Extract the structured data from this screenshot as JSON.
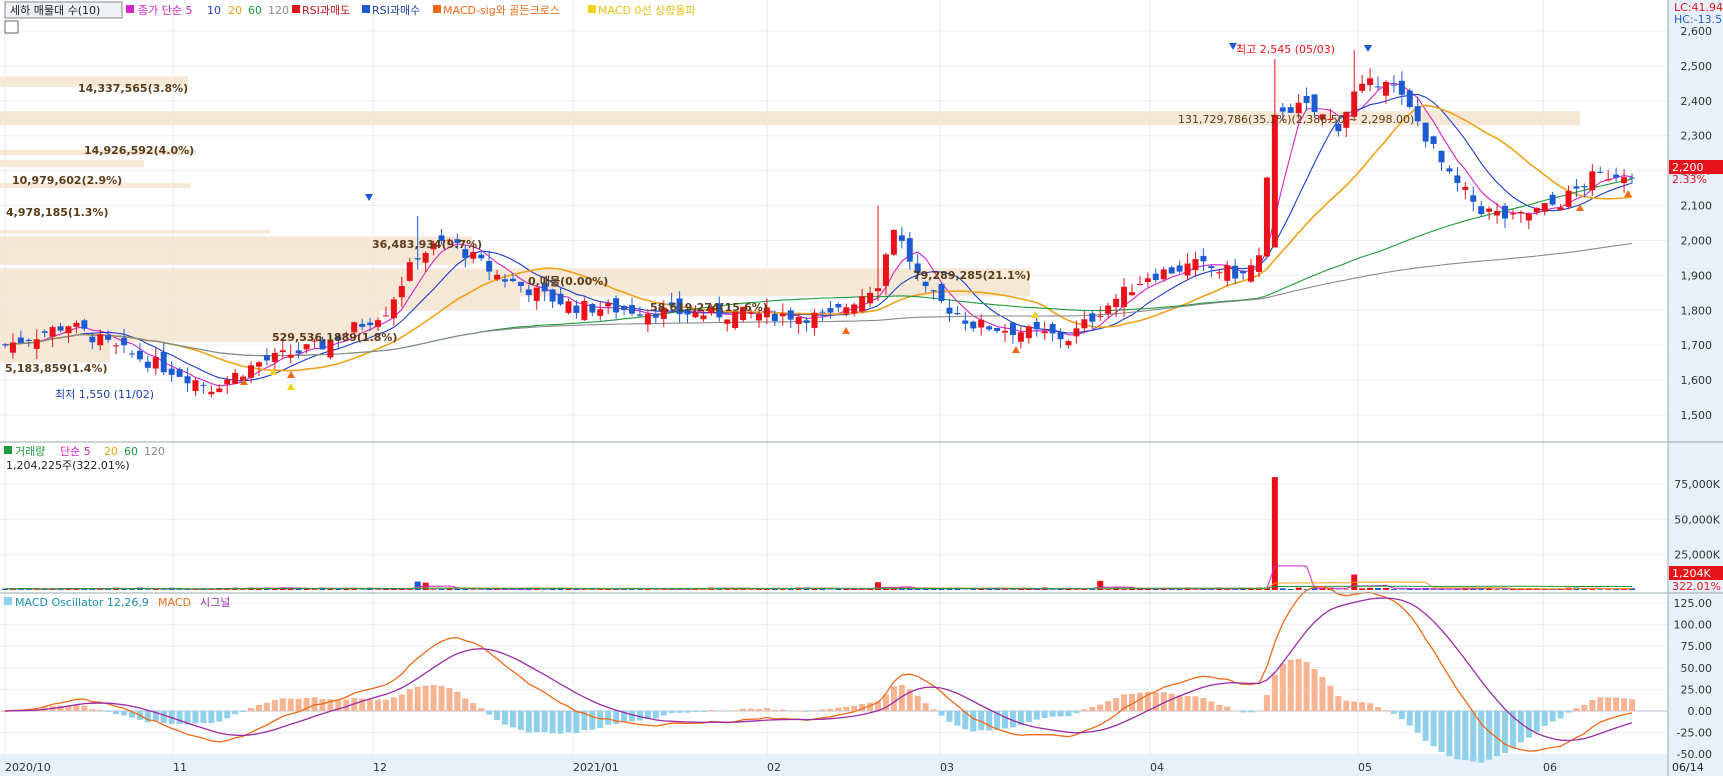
{
  "colors": {
    "up": "#e8121b",
    "down": "#1d5bd3",
    "ma5": "#d524c8",
    "ma10": "#1c3dcc",
    "ma20": "#f0a21b",
    "ma60": "#1e9a3c",
    "ma120": "#8a8a8a",
    "volume_bar_area": "#f5e6d3",
    "macd_line": "#ee6a1a",
    "signal_line": "#9b2ba6",
    "osc_pos": "#f6b493",
    "osc_neg": "#8fd0ec"
  },
  "price_panel": {
    "legend": {
      "title_button": "세하 매물대 수(10)",
      "ma_label": "종가 단순 5",
      "ma10": "10",
      "ma20": "20",
      "ma60": "60",
      "ma120": "120",
      "signal1": "RSI과매도",
      "signal2": "RSI과매수",
      "signal3": "MACD-sig와 골든크로스",
      "signal4": "MACD 0선 상향돌파"
    },
    "corner": {
      "lc": "LC:41.94",
      "hc": "HC:-13.56"
    },
    "price_badge": "2,200",
    "change_badge": "2.33%",
    "high_note": "최고 2,545 (05/03)",
    "low_note": "최저 1,550 (11/02)",
    "range_note": "131,729,786(35.1%)(2,386.50 ~ 2,298.00)",
    "profile_labels": [
      "14,337,565(3.8%)",
      "14,926,592(4.0%)",
      "10,979,602(2.9%)",
      "4,978,185(1.3%)",
      "36,483,934(9.7%)",
      "79,289,285(21.1%)",
      "529,536,1889(1.8%)",
      "5,183,859(1.4%)",
      "0,매물(0.00%)",
      "58,619,274(15.6%)"
    ],
    "y_ticks": [
      "2,600",
      "2,500",
      "2,400",
      "2,300",
      "2,200",
      "2,100",
      "2,000",
      "1,900",
      "1,800",
      "1,700",
      "1,600",
      "1,500"
    ]
  },
  "volume_panel": {
    "legend": {
      "name": "거래량",
      "ma_label": "단순 5",
      "ma20": "20",
      "ma60": "60",
      "ma120": "120"
    },
    "current": "1,204,225주(322.01%)",
    "badge_value": "1,204K",
    "badge_pct": "322.01%",
    "y_ticks": [
      "75,000K",
      "50,000K",
      "25,000K"
    ]
  },
  "macd_panel": {
    "legend": {
      "osc": "MACD Oscillator 12,26,9",
      "macd": "MACD",
      "signal": "시그널"
    },
    "y_ticks": [
      "125.00",
      "100.00",
      "75.00",
      "50.00",
      "25.00",
      "0.00",
      "-25.00",
      "-50.00"
    ]
  },
  "x_axis": {
    "labels": [
      "2020/10",
      "11",
      "12",
      "2021/01",
      "02",
      "03",
      "04",
      "05",
      "06"
    ],
    "end_label": "06/14"
  },
  "chart_data": [
    {
      "type": "candlestick",
      "title": "",
      "ylim": [
        1450,
        2600
      ],
      "start_date": "2020-10-05",
      "end_date": "2021-06-14",
      "ohlc_keypoints": [
        {
          "date": "2020-10",
          "close": 1700
        },
        {
          "date": "2020-11-02",
          "close": 1580,
          "low": 1550
        },
        {
          "date": "2020-12-01",
          "close": 2000,
          "high": 2070
        },
        {
          "date": "2021-01",
          "close": 1790
        },
        {
          "date": "2021-02-18",
          "close": 2040,
          "high": 2100
        },
        {
          "date": "2021-03-08",
          "close": 1720
        },
        {
          "date": "2021-04-16",
          "close": 2380
        },
        {
          "date": "2021-05-03",
          "close": 2420,
          "high": 2545
        },
        {
          "date": "2021-05-25",
          "close": 2040
        },
        {
          "date": "2021-06-14",
          "close": 2200
        }
      ],
      "series": [
        {
          "name": "5",
          "values": []
        },
        {
          "name": "10",
          "values": []
        },
        {
          "name": "20",
          "values": []
        },
        {
          "name": "60",
          "values": []
        },
        {
          "name": "120",
          "values": []
        }
      ],
      "last_close": 2200,
      "change_pct": 2.33
    },
    {
      "type": "bar",
      "title": "",
      "ylim": [
        0,
        85000
      ],
      "peak_volume_k": 80000,
      "last_volume": 1204225,
      "last_volume_pct": 322.01
    },
    {
      "type": "line",
      "title": "",
      "ylim": [
        -50,
        130
      ],
      "series": [
        {
          "name": "MACD",
          "values": []
        },
        {
          "name": "시그널",
          "values": []
        }
      ],
      "macd_peak": 122,
      "signal_peak": 108,
      "osc_min": -38,
      "osc_max": 45
    }
  ]
}
